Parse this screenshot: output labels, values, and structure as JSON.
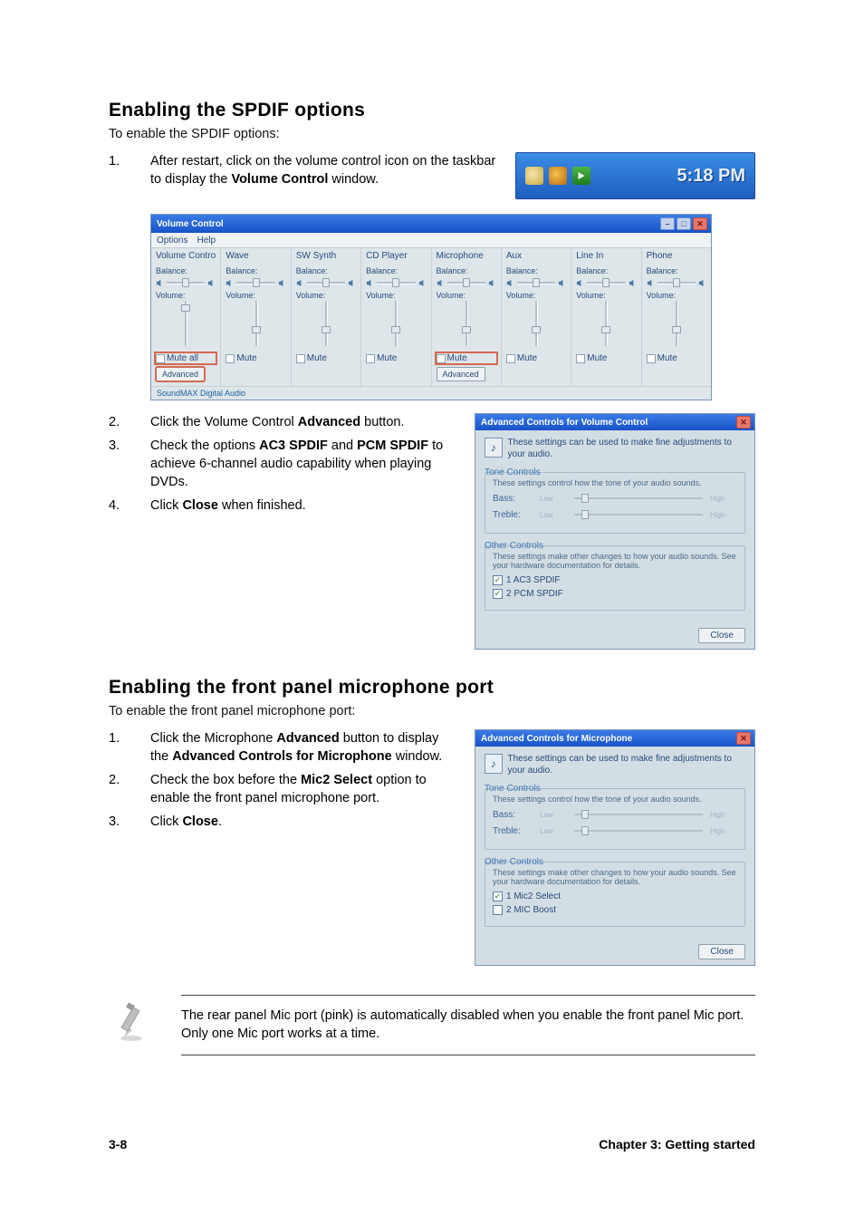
{
  "section1": {
    "heading": "Enabling the SPDIF options",
    "intro": "To enable the SPDIF options:",
    "steps": [
      {
        "num": "1.",
        "html_segments": [
          "After restart, click on the volume control icon on the taskbar to display the ",
          {
            "b": "Volume Control"
          },
          " window."
        ]
      },
      {
        "num": "2.",
        "html_segments": [
          "Click the Volume Control ",
          {
            "b": "Advanced"
          },
          " button."
        ]
      },
      {
        "num": "3.",
        "html_segments": [
          "Check the options ",
          {
            "b": "AC3 SPDIF"
          },
          " and ",
          {
            "b": "PCM SPDIF"
          },
          " to achieve 6-channel audio capability when playing DVDs."
        ]
      },
      {
        "num": "4.",
        "html_segments": [
          "Click ",
          {
            "b": "Close"
          },
          " when finished."
        ]
      }
    ]
  },
  "clock": {
    "time": "5:18 PM"
  },
  "vol_window": {
    "title": "Volume Control",
    "menu": [
      "Options",
      "Help"
    ],
    "balance_label": "Balance:",
    "volume_label": "Volume:",
    "mute_label": "Mute",
    "mute_all_label": "Mute all",
    "advanced_label": "Advanced",
    "status": "SoundMAX Digital Audio",
    "channels": [
      {
        "name": "Volume Control",
        "advanced": true,
        "mute_ringed": true
      },
      {
        "name": "Wave"
      },
      {
        "name": "SW Synth"
      },
      {
        "name": "CD Player"
      },
      {
        "name": "Microphone",
        "advanced": true,
        "mute_ringed": true
      },
      {
        "name": "Aux"
      },
      {
        "name": "Line In"
      },
      {
        "name": "Phone"
      }
    ]
  },
  "adv_vol": {
    "title": "Advanced Controls for Volume Control",
    "desc": "These settings can be used to make fine adjustments to your audio.",
    "tone_title": "Tone Controls",
    "tone_desc": "These settings control how the tone of your audio sounds.",
    "bass_label": "Bass:",
    "treble_label": "Treble:",
    "low": "Low",
    "high": "High",
    "other_title": "Other Controls",
    "other_desc": "These settings make other changes to how your audio sounds. See your hardware documentation for details.",
    "opt1": "1 AC3 SPDIF",
    "opt2": "2 PCM SPDIF",
    "close": "Close"
  },
  "section2": {
    "heading": "Enabling the front panel microphone port",
    "intro": "To enable the front panel microphone port:",
    "steps": [
      {
        "num": "1.",
        "html_segments": [
          "Click the Microphone ",
          {
            "b": "Advanced"
          },
          " button to display the ",
          {
            "b": "Advanced Controls for Microphone"
          },
          " window."
        ]
      },
      {
        "num": "2.",
        "html_segments": [
          "Check the box before the ",
          {
            "b": "Mic2 Select"
          },
          " option to enable the front panel microphone port."
        ]
      },
      {
        "num": "3.",
        "html_segments": [
          "Click ",
          {
            "b": "Close"
          },
          "."
        ]
      }
    ]
  },
  "adv_mic": {
    "title": "Advanced Controls for Microphone",
    "desc": "These settings can be used to make fine adjustments to your audio.",
    "tone_title": "Tone Controls",
    "tone_desc": "These settings control how the tone of your audio sounds.",
    "bass_label": "Bass:",
    "treble_label": "Treble:",
    "low": "Low",
    "high": "High",
    "other_title": "Other Controls",
    "other_desc": "These settings make other changes to how your audio sounds. See your hardware documentation for details.",
    "opt1": "1 Mic2 Select",
    "opt2": "2 MIC Boost",
    "close": "Close"
  },
  "note": "The rear panel Mic port (pink) is automatically disabled when you enable the front panel Mic port. Only one Mic port works at a time.",
  "footer": {
    "left": "3-8",
    "right": "Chapter 3: Getting started"
  }
}
